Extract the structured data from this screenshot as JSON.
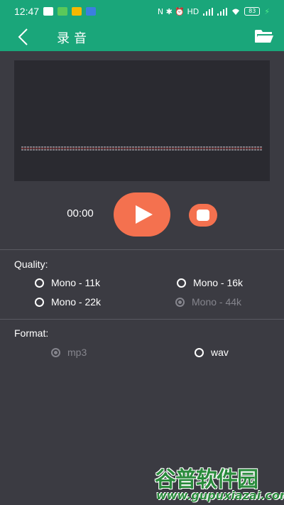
{
  "status_bar": {
    "time": "12:47",
    "right_text": "N ✱ ⏰ HD",
    "battery": "83"
  },
  "app_bar": {
    "title": "录音",
    "back_icon": "back-arrow-icon",
    "folder_icon": "folder-open-icon"
  },
  "recorder": {
    "timer": "00:00",
    "play_icon": "play-icon",
    "stop_icon": "stop-icon",
    "accent_color": "#f4714f"
  },
  "quality": {
    "label": "Quality:",
    "options": [
      {
        "label": "Mono - 11k",
        "selected": false,
        "enabled": true
      },
      {
        "label": "Mono - 16k",
        "selected": false,
        "enabled": true
      },
      {
        "label": "Mono - 22k",
        "selected": false,
        "enabled": true
      },
      {
        "label": "Mono - 44k",
        "selected": true,
        "enabled": false
      }
    ]
  },
  "format": {
    "label": "Format:",
    "options": [
      {
        "label": "mp3",
        "selected": true,
        "enabled": false
      },
      {
        "label": "wav",
        "selected": false,
        "enabled": true
      }
    ]
  },
  "watermark": {
    "name": "谷普软件园",
    "url": "www.gupuxiazai.com"
  },
  "colors": {
    "header": "#1aa67a",
    "background": "#3b3b42",
    "panel": "#2a2a30"
  }
}
